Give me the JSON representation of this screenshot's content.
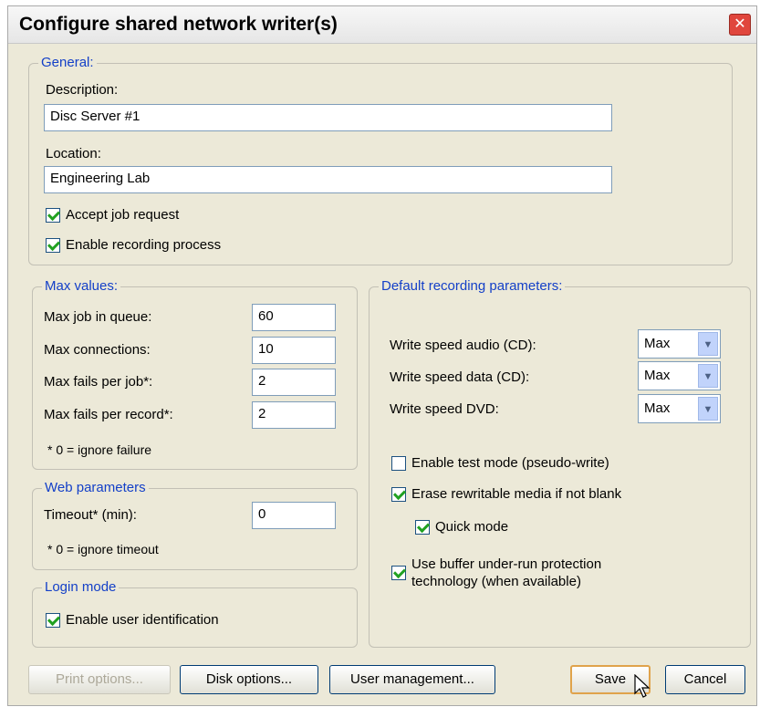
{
  "window": {
    "title": "Configure shared network writer(s)"
  },
  "general": {
    "legend": "General:",
    "description_label": "Description:",
    "description_value": "Disc Server #1",
    "location_label": "Location:",
    "location_value": "Engineering Lab",
    "accept_job": {
      "label": "Accept job request",
      "checked": true
    },
    "enable_recording": {
      "label": "Enable recording process",
      "checked": true
    }
  },
  "max_values": {
    "legend": "Max values:",
    "rows": [
      {
        "label": "Max job in queue:",
        "value": "60"
      },
      {
        "label": "Max connections:",
        "value": "10"
      },
      {
        "label": "Max fails per job*:",
        "value": "2"
      },
      {
        "label": "Max fails per record*:",
        "value": "2"
      }
    ],
    "note": "* 0 = ignore failure"
  },
  "web": {
    "legend": "Web parameters",
    "timeout_label": "Timeout* (min):",
    "timeout_value": "0",
    "note": "* 0 = ignore timeout"
  },
  "login": {
    "legend": "Login mode",
    "user_id": {
      "label": "Enable user identification",
      "checked": true
    }
  },
  "recording": {
    "legend": "Default recording parameters:",
    "speeds": [
      {
        "label": "Write speed audio (CD):",
        "value": "Max"
      },
      {
        "label": "Write speed data (CD):",
        "value": "Max"
      },
      {
        "label": "Write speed DVD:",
        "value": "Max"
      }
    ],
    "test_mode": {
      "label": "Enable test mode (pseudo-write)",
      "checked": false
    },
    "erase": {
      "label": "Erase rewritable media if not blank",
      "checked": true
    },
    "quick": {
      "label": "Quick mode",
      "checked": true
    },
    "buffer": {
      "label_line1": "Use buffer under-run protection",
      "label_line2": "technology (when available)",
      "checked": true
    }
  },
  "buttons": {
    "print": "Print options...",
    "disk": "Disk options...",
    "user": "User management...",
    "save": "Save",
    "cancel": "Cancel"
  }
}
